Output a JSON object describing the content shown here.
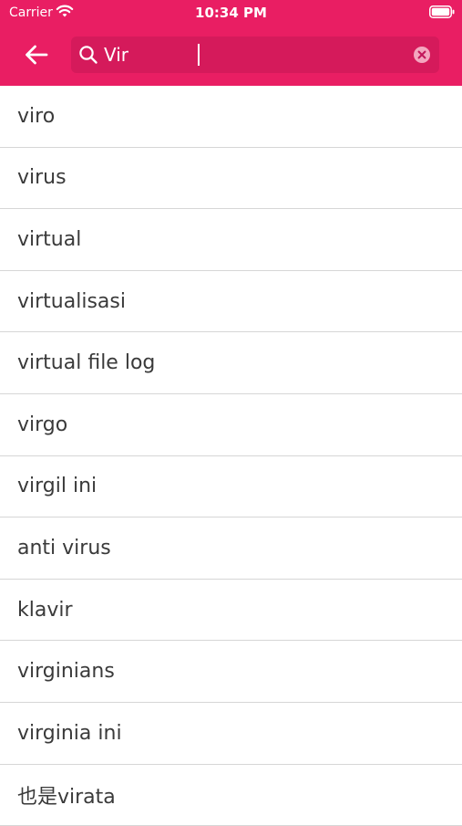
{
  "status_bar": {
    "carrier": "Carrier",
    "time": "10:34 PM",
    "wifi_icon": "wifi-icon",
    "battery_icon": "battery-icon"
  },
  "header": {
    "background_color": "#e91e63",
    "back_icon": "arrow-left-icon",
    "search": {
      "value": "Vir",
      "icon": "search-icon",
      "clear_icon": "clear-circle-icon"
    }
  },
  "results": [
    "viro",
    "virus",
    "virtual",
    "virtualisasi",
    "virtual file log",
    "virgo",
    "virgil ini",
    "anti virus",
    "klavir",
    "virginians",
    "virginia ini",
    "也是virata"
  ]
}
